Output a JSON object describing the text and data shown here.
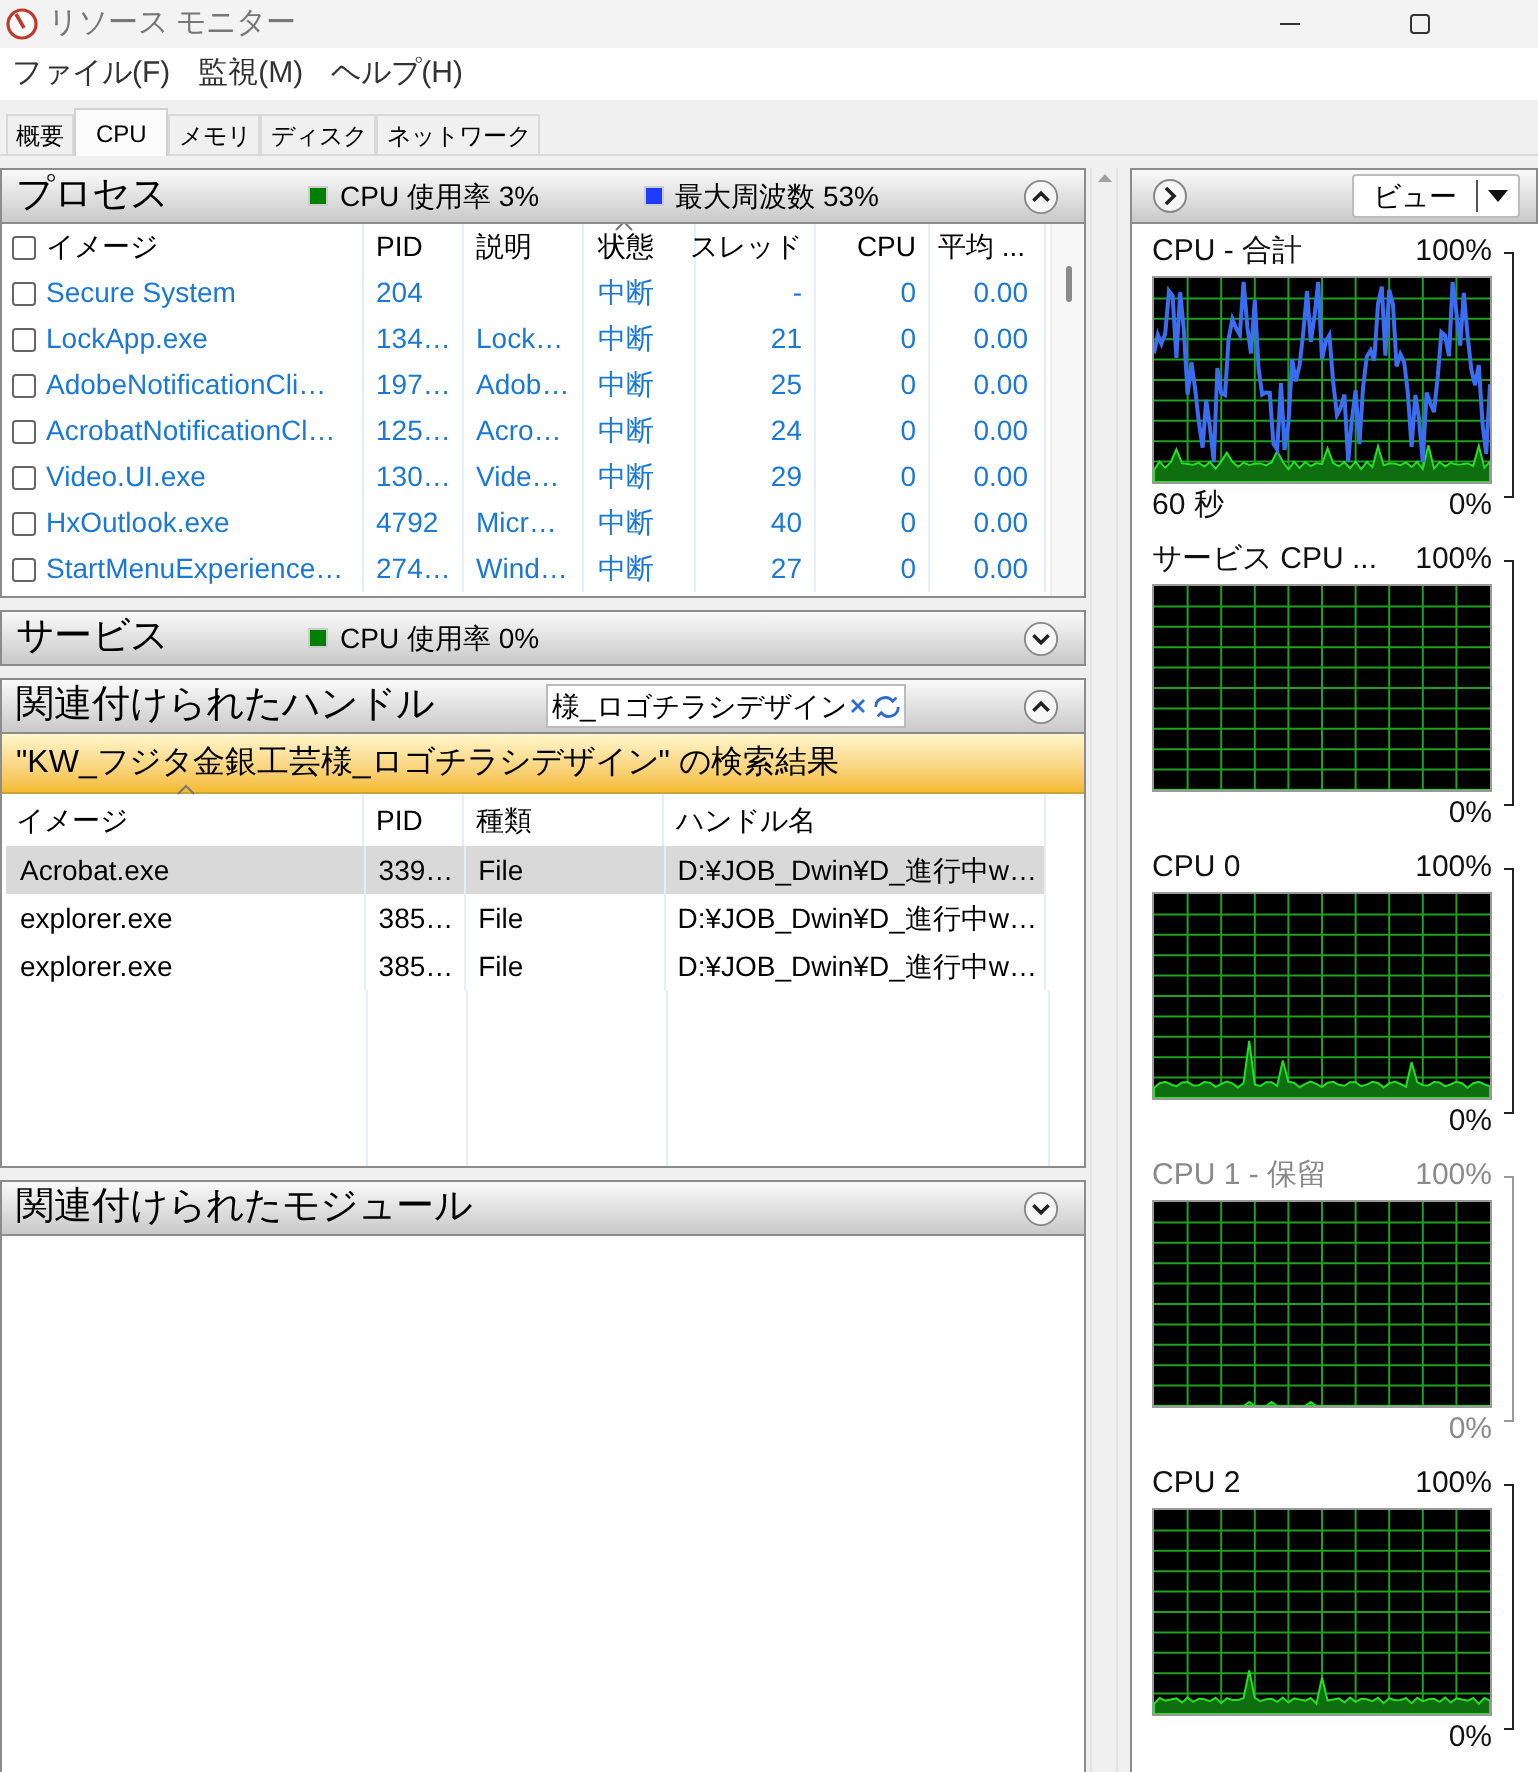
{
  "window": {
    "title": "リソース モニター"
  },
  "menu": [
    "ファイル(F)",
    "監視(M)",
    "ヘルプ(H)"
  ],
  "tabs": [
    {
      "label": "概要",
      "selected": false
    },
    {
      "label": "CPU",
      "selected": true
    },
    {
      "label": "メモリ",
      "selected": false
    },
    {
      "label": "ディスク",
      "selected": false
    },
    {
      "label": "ネットワーク",
      "selected": false
    }
  ],
  "processes": {
    "title": "プロセス",
    "expanded": true,
    "all_checked": false,
    "legend": [
      {
        "label": "CPU 使用率 3%",
        "color": "#008000"
      },
      {
        "label": "最大周波数 53%",
        "color": "#1e3cff"
      }
    ],
    "columns": [
      {
        "label": "イメージ",
        "sorted": false
      },
      {
        "label": "PID",
        "sorted": false
      },
      {
        "label": "説明",
        "sorted": false
      },
      {
        "label": "状態",
        "sorted": true
      },
      {
        "label": "スレッド",
        "sorted": false
      },
      {
        "label": "CPU",
        "sorted": false
      },
      {
        "label": "平均 ...",
        "sorted": false
      }
    ],
    "rows": [
      {
        "checked": false,
        "suspended": true,
        "image": "Secure System",
        "pid": "204",
        "status": "中断",
        "threads": "-",
        "cpu": "0",
        "average": "0.00"
      },
      {
        "checked": false,
        "suspended": true,
        "image": "LockApp.exe",
        "pid": "134…",
        "description": "Lock…",
        "status": "中断",
        "threads": "21",
        "cpu": "0",
        "average": "0.00"
      },
      {
        "checked": false,
        "suspended": true,
        "image": "AdobeNotificationCli…",
        "pid": "197…",
        "description": "Adob…",
        "status": "中断",
        "threads": "25",
        "cpu": "0",
        "average": "0.00"
      },
      {
        "checked": false,
        "suspended": true,
        "image": "AcrobatNotificationCl…",
        "pid": "125…",
        "description": "Acro…",
        "status": "中断",
        "threads": "24",
        "cpu": "0",
        "average": "0.00"
      },
      {
        "checked": false,
        "suspended": true,
        "image": "Video.UI.exe",
        "pid": "130…",
        "description": "Vide…",
        "status": "中断",
        "threads": "29",
        "cpu": "0",
        "average": "0.00"
      },
      {
        "checked": false,
        "suspended": true,
        "image": "HxOutlook.exe",
        "pid": "4792",
        "description": "Micr…",
        "status": "中断",
        "threads": "40",
        "cpu": "0",
        "average": "0.00"
      },
      {
        "checked": false,
        "suspended": true,
        "image": "StartMenuExperience…",
        "pid": "274…",
        "description": "Wind…",
        "status": "中断",
        "threads": "27",
        "cpu": "0",
        "average": "0.00"
      }
    ]
  },
  "services": {
    "title": "サービス",
    "expanded": false,
    "legend": [
      {
        "label": "CPU 使用率 0%",
        "color": "#008000"
      }
    ]
  },
  "handles": {
    "title": "関連付けられたハンドル",
    "expanded": true,
    "search": {
      "value": "様_ロゴチラシデザイン"
    },
    "banner": "\"KW_フジタ金銀工芸様_ロゴチラシデザイン\" の検索結果",
    "columns": [
      {
        "label": "イメージ",
        "sorted": true
      },
      {
        "label": "PID",
        "sorted": false
      },
      {
        "label": "種類",
        "sorted": false
      },
      {
        "label": "ハンドル名",
        "sorted": false
      }
    ],
    "rows": [
      {
        "selected": true,
        "image": "Acrobat.exe",
        "pid": "339…",
        "type": "File",
        "handle_name": "D:¥JOB_Dwin¥D_進行中w…"
      },
      {
        "selected": false,
        "image": "explorer.exe",
        "pid": "385…",
        "type": "File",
        "handle_name": "D:¥JOB_Dwin¥D_進行中w…"
      },
      {
        "selected": false,
        "image": "explorer.exe",
        "pid": "385…",
        "type": "File",
        "handle_name": "D:¥JOB_Dwin¥D_進行中w…"
      }
    ]
  },
  "modules": {
    "title": "関連付けられたモジュール",
    "expanded": false
  },
  "graph_pane": {
    "view_button": "ビュー",
    "graphs": [
      {
        "title": "CPU - 合計",
        "max": "100%",
        "time": "60 秒",
        "min": "0%",
        "parked": false
      },
      {
        "title": "サービス CPU ...",
        "max": "100%",
        "min": "0%",
        "parked": false
      },
      {
        "title": "CPU 0",
        "max": "100%",
        "min": "0%",
        "parked": false
      },
      {
        "title": "CPU 1 - 保留",
        "max": "100%",
        "min": "0%",
        "parked": true
      },
      {
        "title": "CPU 2",
        "max": "100%",
        "min": "0%",
        "parked": false
      }
    ]
  }
}
